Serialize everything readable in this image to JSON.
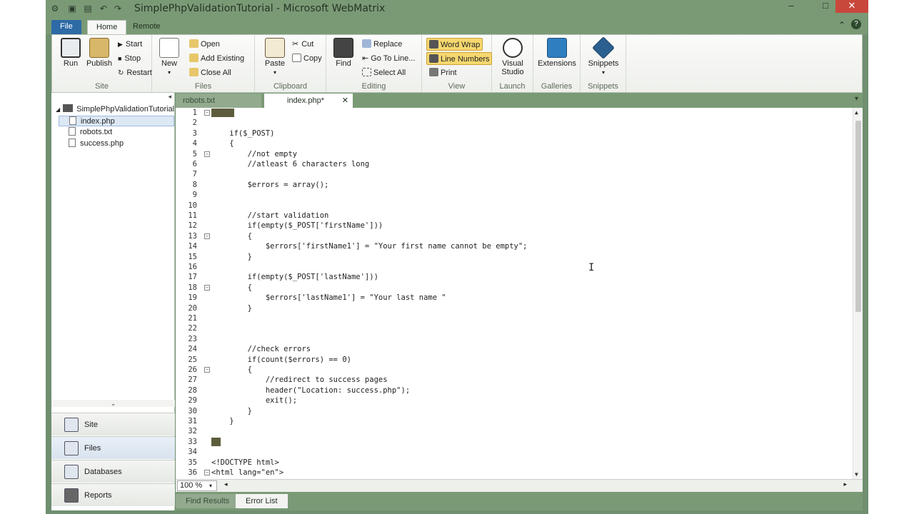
{
  "window": {
    "title": "SimplePhpValidationTutorial - Microsoft WebMatrix",
    "controls": [
      "–",
      "□",
      "✕"
    ]
  },
  "ribbon": {
    "tabs": [
      "File",
      "Home",
      "Remote"
    ],
    "site": {
      "label": "Site",
      "run": "Run",
      "publish": "Publish",
      "start": "Start",
      "stop": "Stop",
      "restart": "Restart"
    },
    "files": {
      "label": "Files",
      "new": "New",
      "open": "Open",
      "add_existing": "Add Existing",
      "close_all": "Close All"
    },
    "clipboard": {
      "label": "Clipboard",
      "paste": "Paste",
      "cut": "Cut",
      "copy": "Copy"
    },
    "editing": {
      "label": "Editing",
      "find": "Find",
      "replace": "Replace",
      "go_to_line": "Go To Line...",
      "select_all": "Select All"
    },
    "view": {
      "label": "View",
      "word_wrap": "Word Wrap",
      "line_numbers": "Line Numbers",
      "print": "Print"
    },
    "launch": {
      "label": "Launch",
      "visual_studio": "Visual Studio"
    },
    "galleries": {
      "label": "Galleries",
      "extensions": "Extensions"
    },
    "snippets": {
      "label": "Snippets",
      "snippets": "Snippets"
    }
  },
  "tree": {
    "root": "SimplePhpValidationTutorial",
    "files": [
      "index.php",
      "robots.txt",
      "success.php"
    ],
    "selected": "index.php"
  },
  "workspaces": [
    "Site",
    "Files",
    "Databases",
    "Reports"
  ],
  "active_workspace": "Files",
  "editor": {
    "tabs": [
      {
        "label": "robots.txt"
      },
      {
        "label": "index.php*"
      }
    ],
    "close_glyph": "✕",
    "zoom": "100 %",
    "lines": [
      {
        "n": "1",
        "t": "",
        "fold": "−",
        "phptag": "<?php"
      },
      {
        "n": "2",
        "t": ""
      },
      {
        "n": "3",
        "t": "    if($_POST)"
      },
      {
        "n": "4",
        "t": "    {"
      },
      {
        "n": "5",
        "t": "        //not empty",
        "fold": "−"
      },
      {
        "n": "6",
        "t": "        //atleast 6 characters long"
      },
      {
        "n": "7",
        "t": ""
      },
      {
        "n": "8",
        "t": "        $errors = array();"
      },
      {
        "n": "9",
        "t": ""
      },
      {
        "n": "10",
        "t": ""
      },
      {
        "n": "11",
        "t": "        //start validation"
      },
      {
        "n": "12",
        "t": "        if(empty($_POST['firstName']))"
      },
      {
        "n": "13",
        "t": "        {",
        "fold": "−"
      },
      {
        "n": "14",
        "t": "            $errors['firstName1'] = \"Your first name cannot be empty\";"
      },
      {
        "n": "15",
        "t": "        }"
      },
      {
        "n": "16",
        "t": ""
      },
      {
        "n": "17",
        "t": "        if(empty($_POST['lastName']))"
      },
      {
        "n": "18",
        "t": "        {",
        "fold": "−"
      },
      {
        "n": "19",
        "t": "            $errors['lastName1'] = \"Your last name \""
      },
      {
        "n": "20",
        "t": "        }"
      },
      {
        "n": "21",
        "t": ""
      },
      {
        "n": "22",
        "t": ""
      },
      {
        "n": "23",
        "t": ""
      },
      {
        "n": "24",
        "t": "        //check errors"
      },
      {
        "n": "25",
        "t": "        if(count($errors) == 0)"
      },
      {
        "n": "26",
        "t": "        {",
        "fold": "−"
      },
      {
        "n": "27",
        "t": "            //redirect to success pages"
      },
      {
        "n": "28",
        "t": "            header(\"Location: success.php\");"
      },
      {
        "n": "29",
        "t": "            exit();"
      },
      {
        "n": "30",
        "t": "        }"
      },
      {
        "n": "31",
        "t": "    }"
      },
      {
        "n": "32",
        "t": ""
      },
      {
        "n": "33",
        "t": "",
        "phptag": "?>"
      },
      {
        "n": "34",
        "t": ""
      },
      {
        "n": "35",
        "t": "<!DOCTYPE html>"
      },
      {
        "n": "36",
        "t": "<html lang=\"en\">",
        "fold": "−"
      }
    ]
  },
  "bottom_tabs": [
    "Find Results",
    "Error List"
  ]
}
